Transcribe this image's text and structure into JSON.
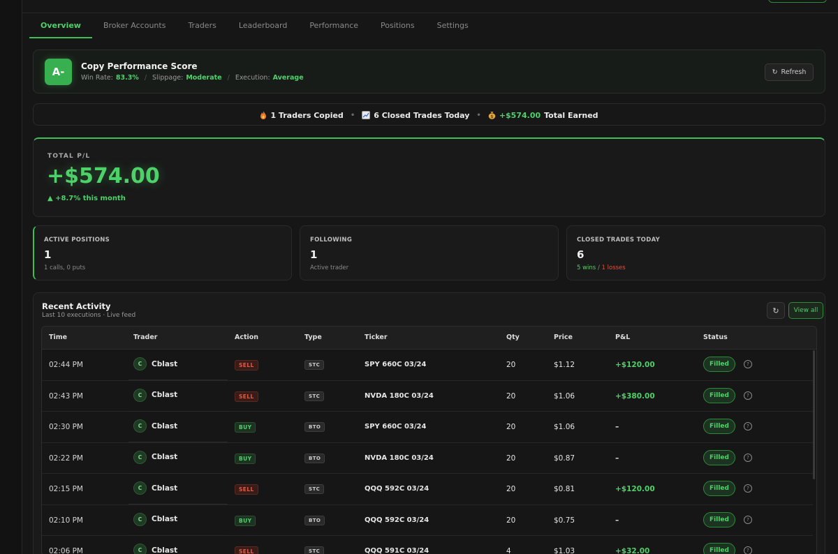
{
  "tabs": [
    {
      "label": "Overview",
      "active": true
    },
    {
      "label": "Broker Accounts",
      "active": false
    },
    {
      "label": "Traders",
      "active": false
    },
    {
      "label": "Leaderboard",
      "active": false
    },
    {
      "label": "Performance",
      "active": false
    },
    {
      "label": "Positions",
      "active": false
    },
    {
      "label": "Settings",
      "active": false
    }
  ],
  "score": {
    "grade": "A-",
    "title": "Copy Performance Score",
    "win_rate_label": "Win Rate:",
    "win_rate": "83.3%",
    "slippage_label": "Slippage:",
    "slippage": "Moderate",
    "execution_label": "Execution:",
    "execution": "Average",
    "refresh_label": "Refresh"
  },
  "summary": {
    "traders_copied": "1 Traders Copied",
    "closed_today": "6 Closed Trades Today",
    "earned_value": "+$574.00",
    "earned_label": "Total Earned"
  },
  "total_pl": {
    "label": "TOTAL P/L",
    "value": "+$574.00",
    "change": "▲ +8.7% this month"
  },
  "stats": [
    {
      "label": "ACTIVE POSITIONS",
      "value": "1",
      "sub": "1 calls, 0 puts"
    },
    {
      "label": "FOLLOWING",
      "value": "1",
      "sub": "Active trader"
    },
    {
      "label": "CLOSED TRADES TODAY",
      "value": "6",
      "wins": "5 wins",
      "slash": " / ",
      "losses": "1 losses"
    }
  ],
  "activity": {
    "title": "Recent Activity",
    "subtitle": "Last 10 executions · Live feed",
    "view_all": "View all",
    "columns": [
      "Time",
      "Trader",
      "Action",
      "Type",
      "Ticker",
      "Qty",
      "Price",
      "P&L",
      "Status"
    ],
    "rows": [
      {
        "time": "02:44 PM",
        "avatar": "C",
        "trader": "Cblast",
        "action": "SELL",
        "type": "STC",
        "ticker": "SPY 660C 03/24",
        "qty": "20",
        "price": "$1.12",
        "pl": "+$120.00",
        "status": "Filled"
      },
      {
        "time": "02:43 PM",
        "avatar": "C",
        "trader": "Cblast",
        "action": "SELL",
        "type": "STC",
        "ticker": "NVDA 180C 03/24",
        "qty": "20",
        "price": "$1.06",
        "pl": "+$380.00",
        "status": "Filled"
      },
      {
        "time": "02:30 PM",
        "avatar": "C",
        "trader": "Cblast",
        "action": "BUY",
        "type": "BTO",
        "ticker": "SPY 660C 03/24",
        "qty": "20",
        "price": "$1.06",
        "pl": "–",
        "status": "Filled"
      },
      {
        "time": "02:22 PM",
        "avatar": "C",
        "trader": "Cblast",
        "action": "BUY",
        "type": "BTO",
        "ticker": "NVDA 180C 03/24",
        "qty": "20",
        "price": "$0.87",
        "pl": "–",
        "status": "Filled"
      },
      {
        "time": "02:15 PM",
        "avatar": "C",
        "trader": "Cblast",
        "action": "SELL",
        "type": "STC",
        "ticker": "QQQ 592C 03/24",
        "qty": "20",
        "price": "$0.81",
        "pl": "+$120.00",
        "status": "Filled"
      },
      {
        "time": "02:10 PM",
        "avatar": "C",
        "trader": "Cblast",
        "action": "BUY",
        "type": "BTO",
        "ticker": "QQQ 592C 03/24",
        "qty": "20",
        "price": "$0.75",
        "pl": "–",
        "status": "Filled"
      },
      {
        "time": "02:06 PM",
        "avatar": "C",
        "trader": "Cblast",
        "action": "SELL",
        "type": "STC",
        "ticker": "QQQ 591C 03/24",
        "qty": "4",
        "price": "$1.03",
        "pl": "+$32.00",
        "status": "Filled"
      }
    ]
  },
  "colors": {
    "accent": "#4fd16a",
    "sell": "#e65a44",
    "background": "#161616"
  },
  "icons": {
    "refresh": "refresh-icon",
    "help": "help-circle-icon",
    "fire": "fire-icon",
    "chart": "chart-icon",
    "money_bag": "money-bag-icon"
  }
}
